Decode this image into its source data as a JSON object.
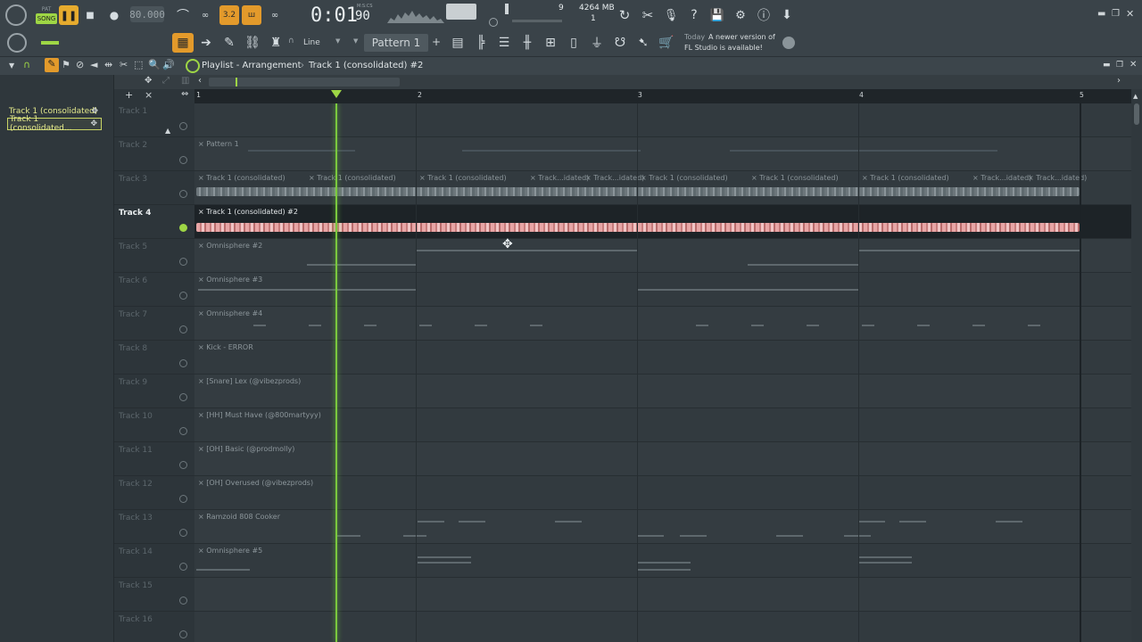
{
  "transport": {
    "song_label": "SONG",
    "pat_label": "PAT",
    "tempo": "80.000",
    "time": "0:01",
    "time_sub": "90",
    "time_unit": "M:S:CS",
    "cpu_count": "9",
    "mem": "4264 MB",
    "poly": "1"
  },
  "toolbar": {
    "snap_label": "Line",
    "pattern_label": "Pattern 1",
    "hint_time": "Today",
    "hint_text_1": "A newer version of",
    "hint_text_2": "FL Studio is available!"
  },
  "playlist": {
    "title": "Playlist - Arrangement",
    "separator": "›",
    "clip_name": "Track 1 (consolidated) #2",
    "ruler": [
      "1",
      "2",
      "3",
      "4",
      "5"
    ]
  },
  "picker": {
    "items": [
      "Track 1 (consolidated)",
      "Track 1 (consolidated..."
    ]
  },
  "tracks": [
    {
      "name": "Track 1",
      "clips": []
    },
    {
      "name": "Track 2",
      "clips": [
        "Pattern 1"
      ]
    },
    {
      "name": "Track 3",
      "clips": [
        "Track 1 (consolidated)",
        "Track 1 (consolidated)",
        "Track 1 (consolidated)",
        "Track...idated)",
        "Track...idated)",
        "Track 1 (consolidated)",
        "Track 1 (consolidated)",
        "Track 1 (consolidated)",
        "Track...idated)",
        "Track...idated)"
      ]
    },
    {
      "name": "Track 4",
      "clips": [
        "Track 1 (consolidated) #2"
      ]
    },
    {
      "name": "Track 5",
      "clips": [
        "Omnisphere #2"
      ]
    },
    {
      "name": "Track 6",
      "clips": [
        "Omnisphere #3"
      ]
    },
    {
      "name": "Track 7",
      "clips": [
        "Omnisphere #4"
      ]
    },
    {
      "name": "Track 8",
      "clips": [
        "Kick - ERROR"
      ]
    },
    {
      "name": "Track 9",
      "clips": [
        "[Snare] Lex (@vibezprods)"
      ]
    },
    {
      "name": "Track 10",
      "clips": [
        "[HH] Must Have (@800martyyy)"
      ]
    },
    {
      "name": "Track 11",
      "clips": [
        "[OH] Basic (@prodmolly)"
      ]
    },
    {
      "name": "Track 12",
      "clips": [
        "[OH] Overused (@vibezprods)"
      ]
    },
    {
      "name": "Track 13",
      "clips": [
        "Ramzoid 808 Cooker"
      ]
    },
    {
      "name": "Track 14",
      "clips": [
        "Omnisphere #5"
      ]
    },
    {
      "name": "Track 15",
      "clips": []
    },
    {
      "name": "Track 16",
      "clips": []
    }
  ],
  "colors": {
    "accent_orange": "#e39a2b",
    "playhead_green": "#7bc93e",
    "active_wave": "#e7a5a5",
    "grey_wave": "#8a9499"
  }
}
